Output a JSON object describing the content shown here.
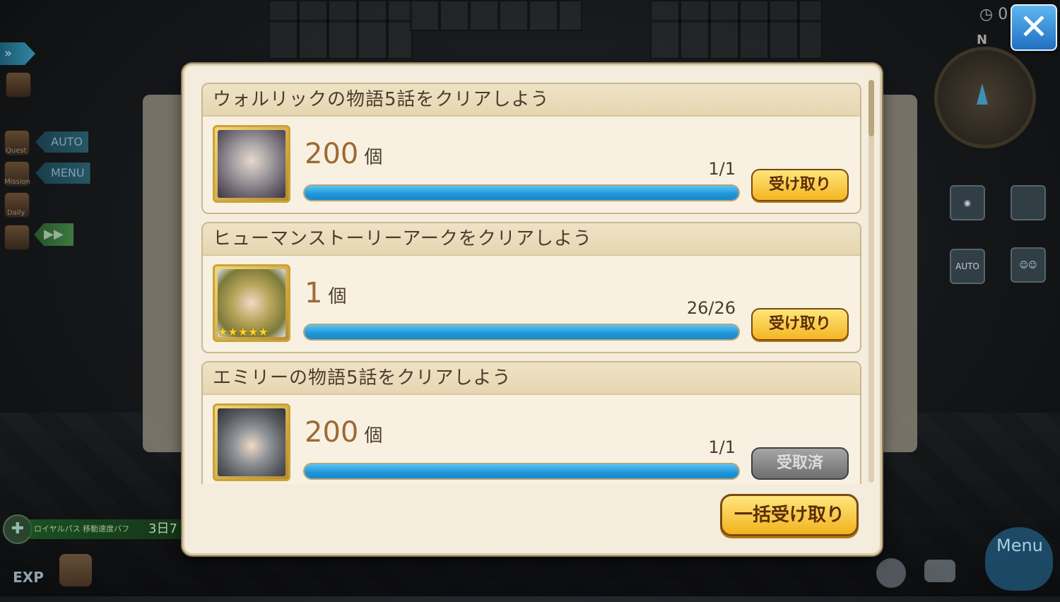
{
  "hud_left": {
    "auto_label": "AUTO",
    "menu_label": "MENU",
    "quest_label": "Quest",
    "mission_label": "Mission",
    "daily_label": "Daily",
    "buff_text": "ロイヤルパス 移動速度バフ",
    "buff_time": "3日7",
    "exp_label": "EXP"
  },
  "hud_right": {
    "clock_value": "0",
    "compass_n": "N",
    "auto_small": "AUTO",
    "menu_label": "Menu",
    "close_glyph": "✕"
  },
  "missions": [
    {
      "title": "ウォルリックの物語5話をクリアしよう",
      "quantity": "200",
      "unit": "個",
      "progress_text": "1/1",
      "progress": 1.0,
      "button": "受け取り",
      "claimed": false
    },
    {
      "title": "ヒューマンストーリーアークをクリアしよう",
      "quantity": "1",
      "unit": "個",
      "stars": "★★★★★",
      "progress_text": "26/26",
      "progress": 1.0,
      "button": "受け取り",
      "claimed": false
    },
    {
      "title": "エミリーの物語5話をクリアしよう",
      "quantity": "200",
      "unit": "個",
      "progress_text": "1/1",
      "progress": 1.0,
      "button": "受取済",
      "claimed": true
    }
  ],
  "receive_all_label": "一括受け取り",
  "colors": {
    "accent_blue": "#1f94d8",
    "button_gold": "#f3b623",
    "panel_bg": "#f4ecdc"
  }
}
